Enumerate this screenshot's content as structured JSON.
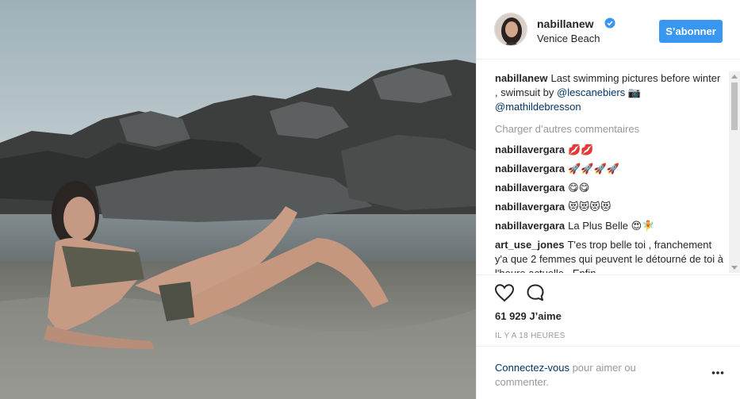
{
  "post": {
    "username": "nabillanew",
    "location": "Venice Beach",
    "follow_label": "S’abonner",
    "caption": {
      "user": "nabillanew",
      "text": "Last swimming pictures before winter , swimsuit by",
      "mention1": "@lescanebiers",
      "emoji": "📷",
      "mention2": "@mathildebresson"
    },
    "load_more": "Charger d’autres commentaires",
    "comments": [
      {
        "user": "nabillavergara",
        "text": "💋💋"
      },
      {
        "user": "nabillavergara",
        "text": "🚀🚀🚀🚀"
      },
      {
        "user": "nabillavergara",
        "text": "😋😋"
      },
      {
        "user": "nabillavergara",
        "text": "😻😻😻😻"
      },
      {
        "user": "nabillavergara",
        "text": "La Plus Belle 😍🧚"
      },
      {
        "user": "art_use_jones",
        "text": "T'es trop belle toi , franchement y'a que 2 femmes qui peuvent le détourné de toi à l'heure actuelle . Enfin"
      }
    ],
    "likes": "61 929 J’aime",
    "time": "IL Y A 18 HEURES",
    "login": {
      "link": "Connectez-vous",
      "text": " pour aimer ou commenter."
    }
  },
  "icons": {
    "verified": "verified-badge-icon",
    "like": "heart-icon",
    "comment": "comment-bubble-icon",
    "more": "more-options-icon"
  },
  "colors": {
    "accent": "#3897f0",
    "link": "#003569",
    "muted": "#999999"
  }
}
